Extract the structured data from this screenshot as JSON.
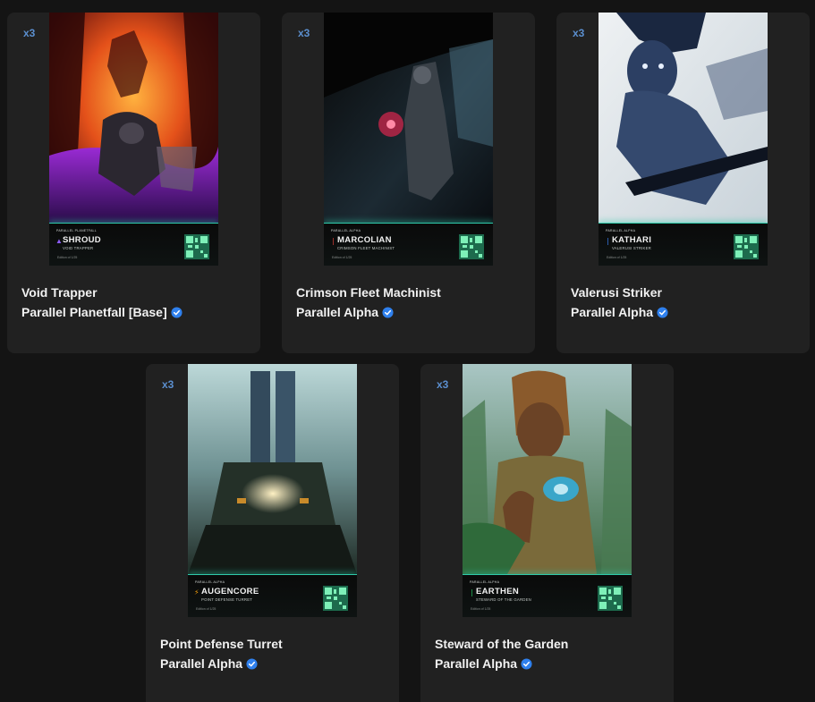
{
  "cards": [
    {
      "quantity": "x3",
      "card_name": "SHROUD",
      "card_subtitle": "VOID TRAPPER",
      "card_set": "PARALLEL PLANETFALL",
      "card_edition": "Edition of 1/25",
      "glyph": "▲",
      "glyph_color": "#8b5cf6",
      "title": "Void Trapper",
      "collection": "Parallel Planetfall [Base]"
    },
    {
      "quantity": "x3",
      "card_name": "MARCOLIAN",
      "card_subtitle": "CRIMSON FLEET MACHINIST",
      "card_set": "PARALLEL ALPHA",
      "card_edition": "Edition of 1/25",
      "glyph": "❘",
      "glyph_color": "#e0413b",
      "title": "Crimson Fleet Machinist",
      "collection": "Parallel Alpha"
    },
    {
      "quantity": "x3",
      "card_name": "KATHARI",
      "card_subtitle": "VALERUSI STRIKER",
      "card_set": "PARALLEL ALPHA",
      "card_edition": "Edition of 1/25",
      "glyph": "❘",
      "glyph_color": "#3b82f6",
      "title": "Valerusi Striker",
      "collection": "Parallel Alpha"
    },
    {
      "quantity": "x3",
      "card_name": "AUGENCORE",
      "card_subtitle": "POINT DEFENSE TURRET",
      "card_set": "PARALLEL ALPHA",
      "card_edition": "Edition of 1/25",
      "glyph": "⚡",
      "glyph_color": "#f59e0b",
      "title": "Point Defense Turret",
      "collection": "Parallel Alpha"
    },
    {
      "quantity": "x3",
      "card_name": "EARTHEN",
      "card_subtitle": "STEWARD OF THE GARDEN",
      "card_set": "PARALLEL ALPHA",
      "card_edition": "Edition of 1/25",
      "glyph": "❘",
      "glyph_color": "#22c55e",
      "title": "Steward of the Garden",
      "collection": "Parallel Alpha"
    }
  ],
  "colors": {
    "background": "#141414",
    "tile": "#212121",
    "quantity": "#5b8fcf",
    "verified": "#2f80ed",
    "card_glow": "#2ec9a9"
  },
  "icons": {
    "verified": "verified-badge-icon",
    "qr": "qr-code-icon"
  }
}
